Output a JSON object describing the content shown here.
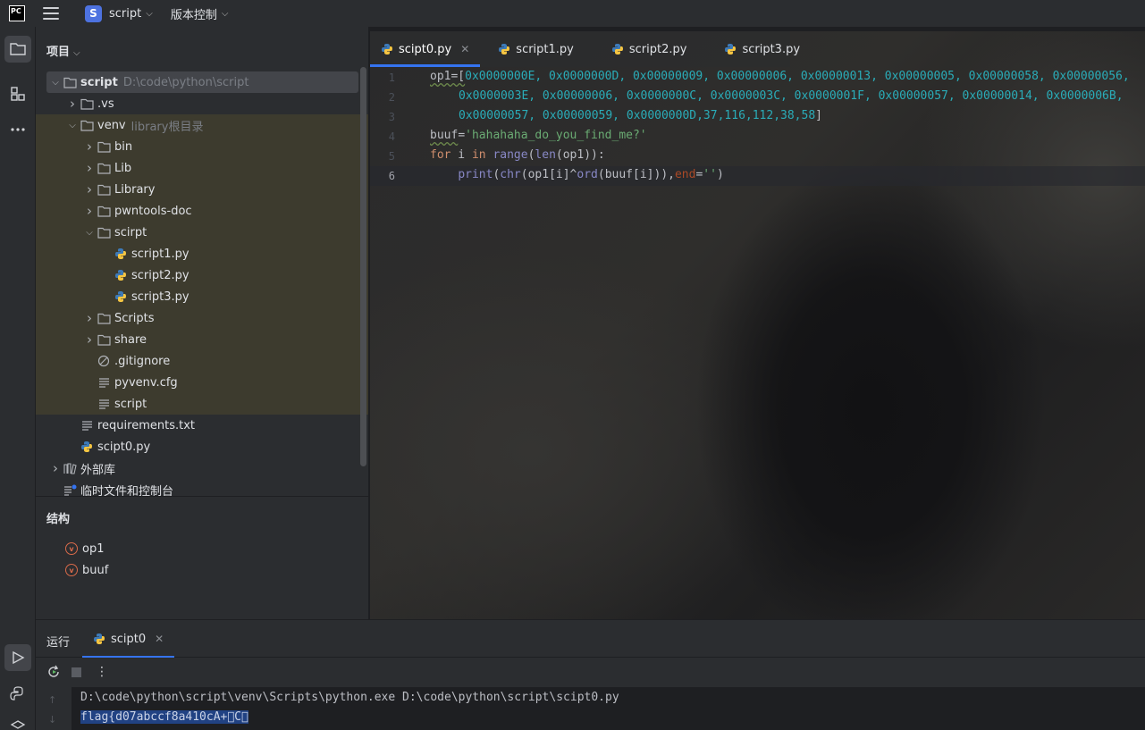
{
  "titlebar": {
    "logo_text": "PC",
    "project_badge": "S",
    "project_name": "script",
    "vcs_label": "版本控制"
  },
  "project_panel": {
    "title": "项目",
    "tree": [
      {
        "label": "script",
        "hint": "D:\\code\\python\\script",
        "type": "folder",
        "expanded": true
      },
      {
        "label": ".vs",
        "type": "folder",
        "expanded": false
      },
      {
        "label": "venv",
        "hint": "library根目录",
        "type": "folder",
        "expanded": true
      },
      {
        "label": "bin",
        "type": "folder",
        "expanded": false
      },
      {
        "label": "Lib",
        "type": "folder",
        "expanded": false
      },
      {
        "label": "Library",
        "type": "folder",
        "expanded": false
      },
      {
        "label": "pwntools-doc",
        "type": "folder",
        "expanded": false
      },
      {
        "label": "scirpt",
        "type": "folder",
        "expanded": true
      },
      {
        "label": "script1.py",
        "type": "python"
      },
      {
        "label": "script2.py",
        "type": "python"
      },
      {
        "label": "script3.py",
        "type": "python"
      },
      {
        "label": "Scripts",
        "type": "folder",
        "expanded": false
      },
      {
        "label": "share",
        "type": "folder",
        "expanded": false
      },
      {
        "label": ".gitignore",
        "type": "ignore"
      },
      {
        "label": "pyvenv.cfg",
        "type": "text"
      },
      {
        "label": "script",
        "type": "text"
      },
      {
        "label": "requirements.txt",
        "type": "text"
      },
      {
        "label": "scipt0.py",
        "type": "python"
      },
      {
        "label": "外部库",
        "type": "library",
        "expanded": false
      },
      {
        "label": "临时文件和控制台",
        "type": "scratch"
      }
    ]
  },
  "structure_panel": {
    "title": "结构",
    "items": [
      {
        "badge": "v",
        "label": "op1"
      },
      {
        "badge": "v",
        "label": "buuf"
      }
    ]
  },
  "editor": {
    "tabs": [
      {
        "label": "scipt0.py",
        "active": true
      },
      {
        "label": "script1.py",
        "active": false
      },
      {
        "label": "script2.py",
        "active": false
      },
      {
        "label": "script3.py",
        "active": false
      }
    ],
    "line_numbers": [
      "1",
      "2",
      "3",
      "4",
      "5",
      "6"
    ],
    "current_line": 6,
    "code": {
      "l1_prefix": "op1=[",
      "l1_values": "0x0000000E, 0x0000000D, 0x00000009, 0x00000006, 0x00000013, 0x00000005, 0x00000058, 0x00000056,",
      "l2_values": "0x0000003E, 0x00000006, 0x0000000C, 0x0000003C, 0x0000001F, 0x00000057, 0x00000014, 0x0000006B,",
      "l3_values": "0x00000057, 0x00000059, 0x0000000D",
      "l3_decimals": ",37,116,112,38,58",
      "l3_suffix": "]",
      "l4_name": "buuf",
      "l4_eq": "=",
      "l4_string": "'hahahaha_do_you_find_me?'",
      "l5_for": "for",
      "l5_i": " i ",
      "l5_in": "in",
      "l5_range": "range",
      "l5_open": "(",
      "l5_len": "len",
      "l5_rest": "(op1)):",
      "l6_indent": "    ",
      "l6_print": "print",
      "l6_open": "(",
      "l6_chr": "chr",
      "l6_mid": "(op1[i]^",
      "l6_ord": "ord",
      "l6_tail": "(buuf[i])),",
      "l6_end": "end",
      "l6_eq": "=",
      "l6_str": "''",
      "l6_close": ")"
    }
  },
  "run_panel": {
    "title": "运行",
    "tab_label": "scipt0",
    "command": "D:\\code\\python\\script\\venv\\Scripts\\python.exe D:\\code\\python\\script\\scipt0.py",
    "output": "flag{d07abccf8a410cA+\u0000C\u0000"
  },
  "colors": {
    "accent": "#3574f0",
    "panel_bg": "#2b2d30",
    "editor_bg": "#1e1f22",
    "highlight_excluded": "#3d3b2e",
    "hex_number": "#2aacb8",
    "keyword": "#cf8e6d",
    "string": "#6aab73",
    "builtin": "#8888c6",
    "param": "#aa4926"
  }
}
